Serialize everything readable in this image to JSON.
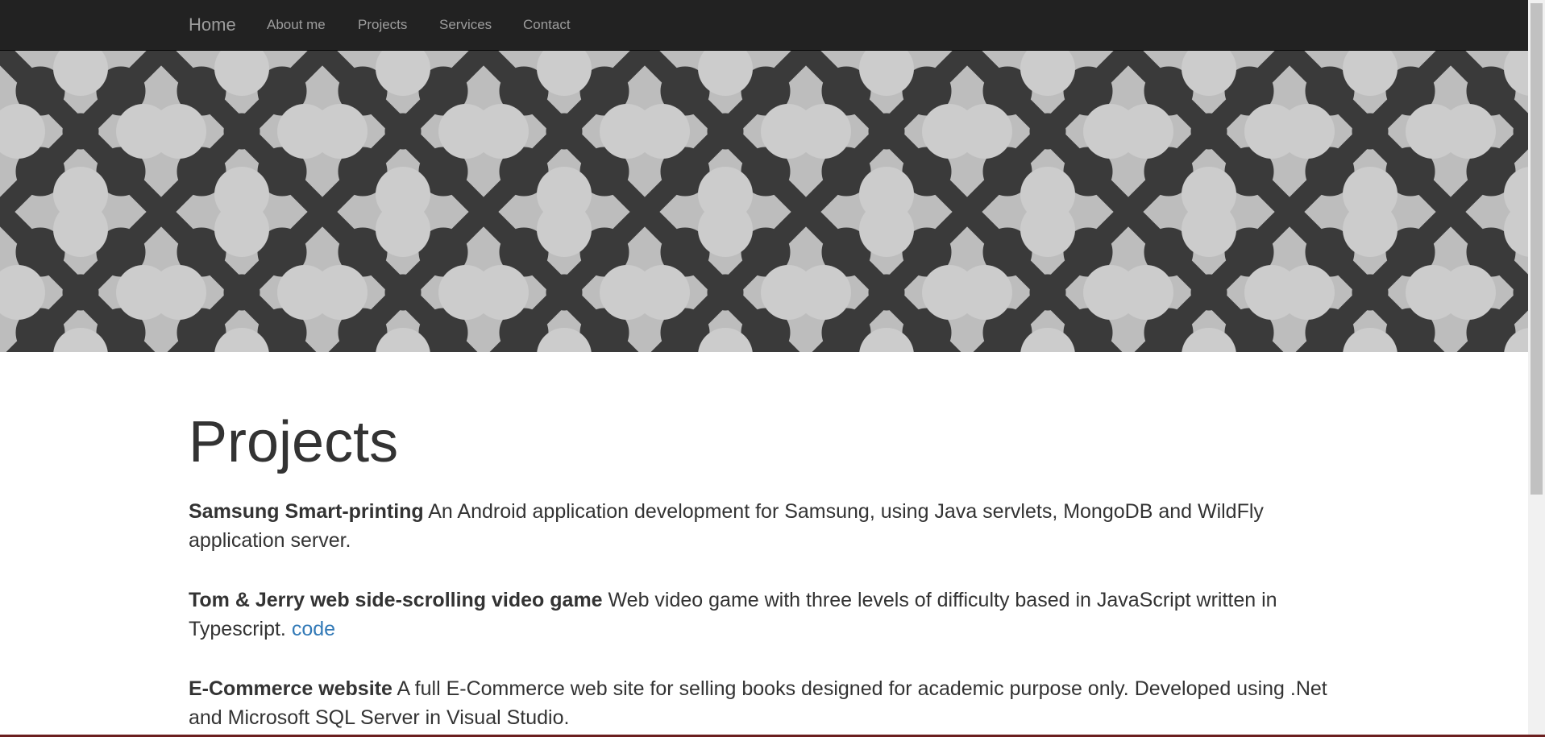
{
  "nav": {
    "brand": "Home",
    "items": [
      "About me",
      "Projects",
      "Services",
      "Contact"
    ]
  },
  "main": {
    "title": "Projects",
    "projects": [
      {
        "title": "Samsung Smart-printing",
        "description": " An Android application development for Samsung, using Java servlets, MongoDB and WildFly application server."
      },
      {
        "title": "Tom & Jerry web side-scrolling video game",
        "description": " Web video game with three levels of difficulty based in JavaScript written in Typescript. ",
        "link": "code"
      },
      {
        "title": "E-Commerce website",
        "description": " A full E-Commerce web site for selling books designed for academic purpose only. Developed using .Net and Microsoft SQL Server in Visual Studio."
      }
    ]
  },
  "colors": {
    "navbar_bg": "#222222",
    "nav_text": "#9d9d9d",
    "link": "#337ab7",
    "text": "#333333"
  }
}
